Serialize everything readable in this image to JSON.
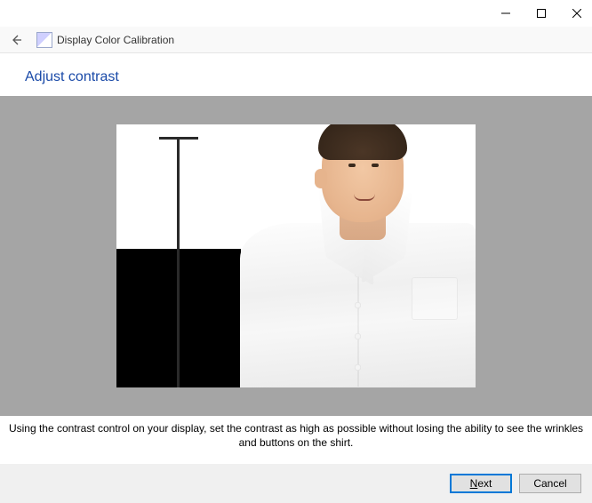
{
  "window": {
    "app_title": "Display Color Calibration"
  },
  "page": {
    "heading": "Adjust contrast",
    "instruction": "Using the contrast control on your display, set the contrast as high as possible without losing the ability to see the wrinkles and buttons on the shirt."
  },
  "footer": {
    "next_label_prefix": "N",
    "next_label_rest": "ext",
    "cancel_label": "Cancel"
  }
}
